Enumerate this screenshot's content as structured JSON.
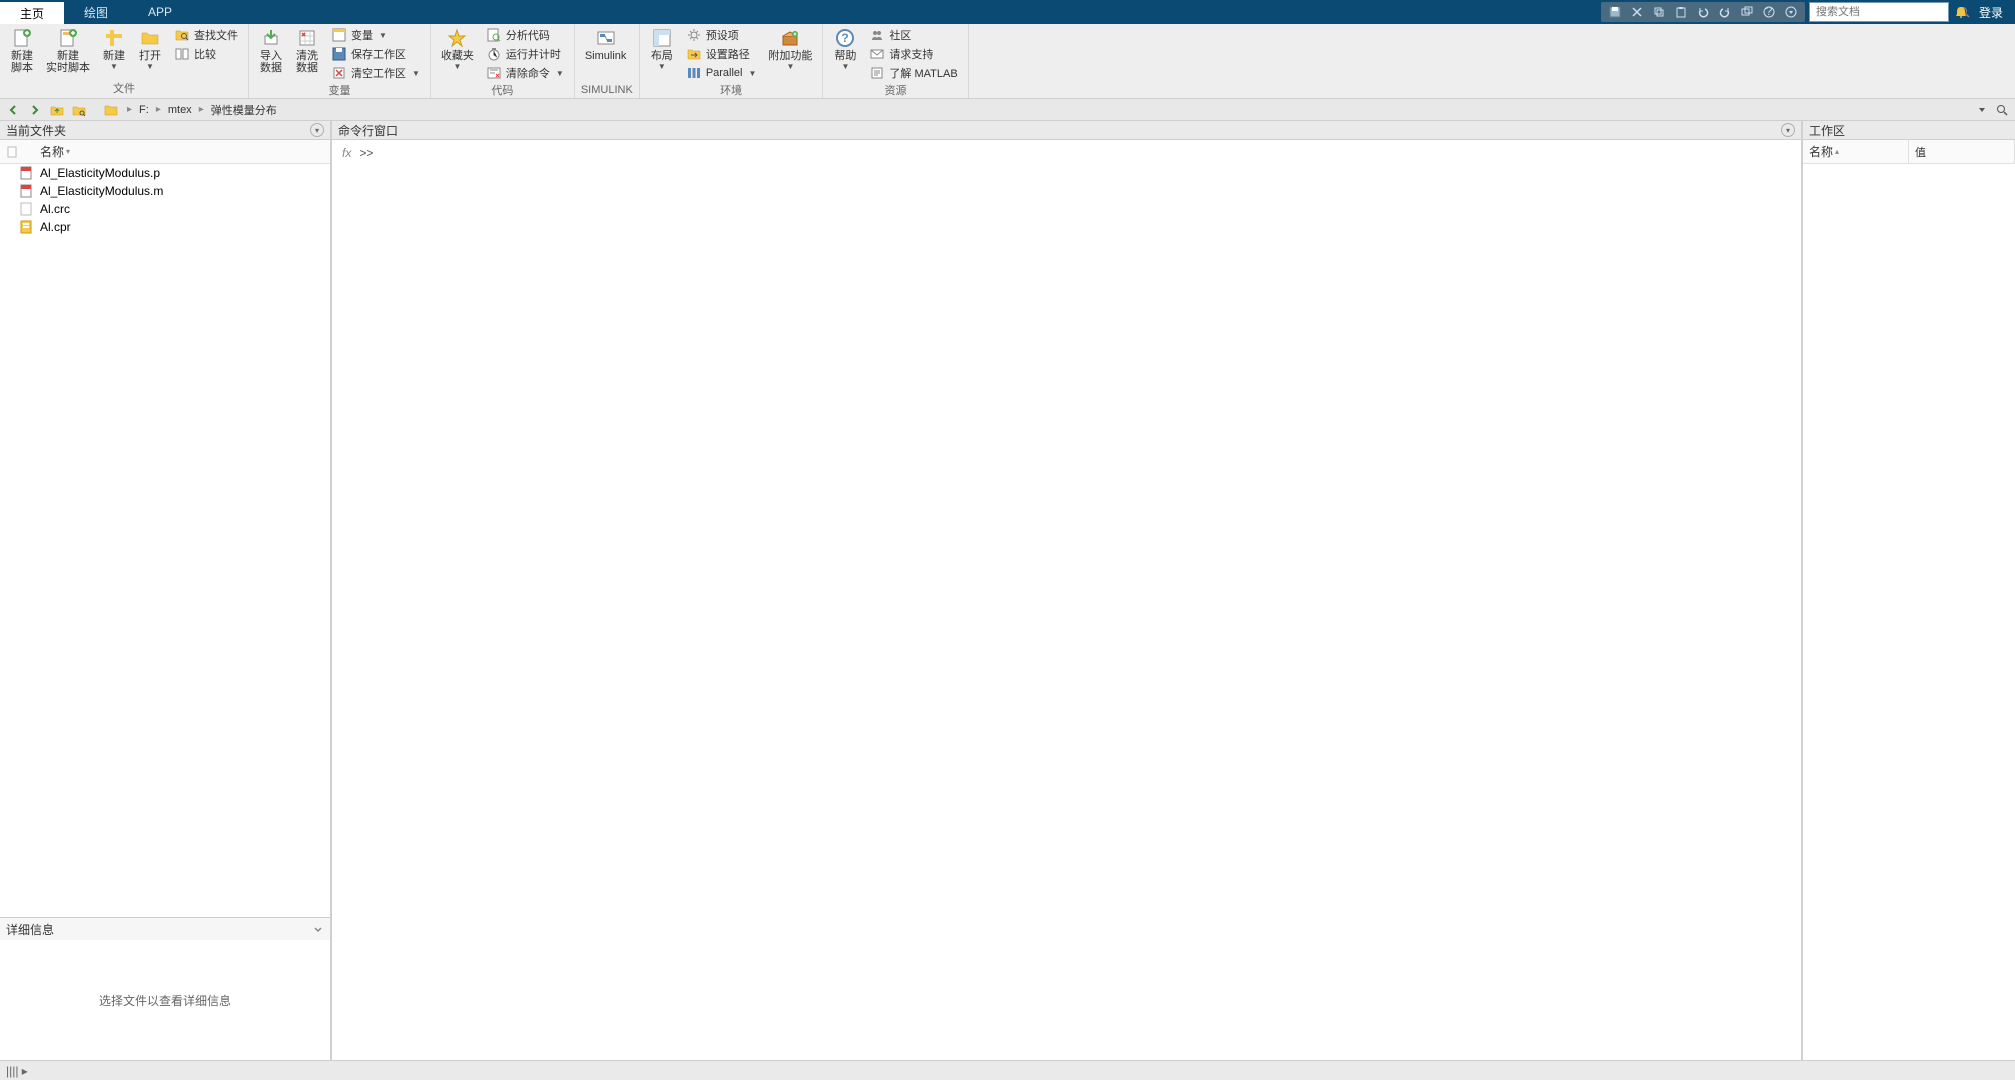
{
  "tabs": {
    "home": "主页",
    "plot": "绘图",
    "app": "APP"
  },
  "search": {
    "placeholder": "搜索文档"
  },
  "login": "登录",
  "ribbon": {
    "file_group": "文件",
    "new_script": "新建\n脚本",
    "new_live": "新建\n实时脚本",
    "new": "新建",
    "open": "打开",
    "find_files": "查找文件",
    "compare": "比较",
    "var_group": "变量",
    "import": "导入\n数据",
    "clean": "清洗\n数据",
    "variable": "变量",
    "save_ws": "保存工作区",
    "clear_ws": "清空工作区",
    "code_group": "代码",
    "favorites": "收藏夹",
    "analyze": "分析代码",
    "run_time": "运行并计时",
    "clear_cmd": "清除命令",
    "simulink_group": "SIMULINK",
    "simulink": "Simulink",
    "env_group": "环境",
    "layout": "布局",
    "prefs": "预设项",
    "set_path": "设置路径",
    "parallel": "Parallel",
    "addons": "附加功能",
    "res_group": "资源",
    "help": "帮助",
    "community": "社区",
    "support": "请求支持",
    "learn": "了解 MATLAB"
  },
  "path": {
    "drive": "F:",
    "p1": "mtex",
    "p2": "弹性模量分布"
  },
  "panels": {
    "current_folder": "当前文件夹",
    "name_col": "名称",
    "command_window": "命令行窗口",
    "workspace": "工作区",
    "ws_name": "名称",
    "ws_value": "值",
    "details": "详细信息",
    "details_hint": "选择文件以查看详细信息"
  },
  "files": [
    {
      "name": "Al_ElasticityModulus.p",
      "type": "p"
    },
    {
      "name": "Al_ElasticityModulus.m",
      "type": "m"
    },
    {
      "name": "Al.crc",
      "type": "crc"
    },
    {
      "name": "Al.cpr",
      "type": "cpr"
    }
  ],
  "prompt": ">>"
}
